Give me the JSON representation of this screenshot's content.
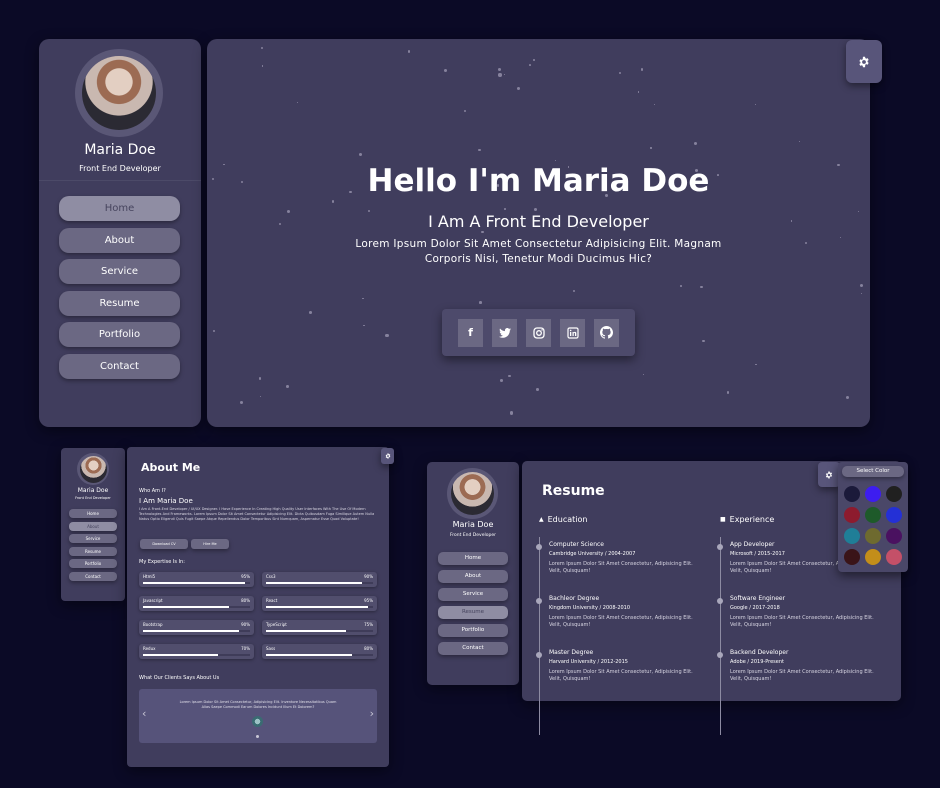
{
  "main": {
    "profile": {
      "name": "Maria Doe",
      "role": "Front End Developer"
    },
    "nav": [
      "Home",
      "About",
      "Service",
      "Resume",
      "Portfolio",
      "Contact"
    ],
    "nav_active": "Home",
    "hero": {
      "title": "Hello I'm Maria Doe",
      "subtitle": "I Am A Front End Developer",
      "description": "Lorem Ipsum Dolor Sit Amet Consectetur Adipisicing Elit. Magnam Corporis Nisi, Tenetur Modi Ducimus Hic?"
    },
    "social": [
      "facebook-icon",
      "twitter-icon",
      "instagram-icon",
      "linkedin-icon",
      "github-icon"
    ]
  },
  "about_page": {
    "profile": {
      "name": "Maria Doe",
      "role": "Front End Developer"
    },
    "nav": [
      "Home",
      "About",
      "Service",
      "Resume",
      "Portfolio",
      "Contact"
    ],
    "nav_active": "About",
    "title": "About Me",
    "who_label": "Who Am I?",
    "who_name": "I Am Maria Doe",
    "bio": "I Am A Front-End Developer / UI/UX Designer. I Have Experience In Creating High Quality User Interfaces With The Use Of Modern Technologies And Frameworks. Lorem Ipsum Dolor Sit Amet Consectetur Adipisicing Elit. Dicta Quibusdam Fuga Similique Autem Nulla Natus Optio Eligendi Quis Fugit Saepe Atque Repellendus Dolor Temporibus Sint Numquam, Aspernatur Esse Quod Voluptate!",
    "buttons": [
      "Download CV",
      "Hire Me"
    ],
    "expertise_title": "My Expertise Is In:",
    "skills": [
      {
        "name": "Html5",
        "value": 95,
        "label": "95%"
      },
      {
        "name": "Css3",
        "value": 90,
        "label": "90%"
      },
      {
        "name": "Javascript",
        "value": 80,
        "label": "80%"
      },
      {
        "name": "React",
        "value": 95,
        "label": "95%"
      },
      {
        "name": "Bootstrap",
        "value": 90,
        "label": "90%"
      },
      {
        "name": "TypeScript",
        "value": 75,
        "label": "75%"
      },
      {
        "name": "Redux",
        "value": 70,
        "label": "70%"
      },
      {
        "name": "Sass",
        "value": 80,
        "label": "80%"
      }
    ],
    "clients_title": "What Our Clients Says About Us",
    "testimonial": "Lorem Ipsum Dolor Sit Amet Consectetur, Adipisicing Elit. Inventore Necessitatibus Quam Alias Saepe Commodi Earum Dolores Incidunt Illum Et Dolorem?"
  },
  "resume_page": {
    "profile": {
      "name": "Maria Doe",
      "role": "Front End Developer"
    },
    "nav": [
      "Home",
      "About",
      "Service",
      "Resume",
      "Portfolio",
      "Contact"
    ],
    "nav_active": "Resume",
    "title": "Resume",
    "education_title": "Education",
    "experience_title": "Experience",
    "education": [
      {
        "title": "Computer Science",
        "sub": "Cambridge University / 2004-2007",
        "desc": "Lorem Ipsum Dolor Sit Amet Consectetur, Adipisicing Elit. Velit, Quisquam!"
      },
      {
        "title": "Bachleor Degree",
        "sub": "Kingdom University / 2008-2010",
        "desc": "Lorem Ipsum Dolor Sit Amet Consectetur, Adipisicing Elit. Velit, Quisquam!"
      },
      {
        "title": "Master Degree",
        "sub": "Harvard University / 2012-2015",
        "desc": "Lorem Ipsum Dolor Sit Amet Consectetur, Adipisicing Elit. Velit, Quisquam!"
      }
    ],
    "experience": [
      {
        "title": "App Developer",
        "sub": "Microsoft / 2015-2017",
        "desc": "Lorem Ipsum Dolor Sit Amet Consectetur, Adipisicing Elit. Velit, Quisquam!"
      },
      {
        "title": "Software Engineer",
        "sub": "Google / 2017-2018",
        "desc": "Lorem Ipsum Dolor Sit Amet Consectetur, Adipisicing Elit. Velit, Quisquam!"
      },
      {
        "title": "Backend Developer",
        "sub": "Adobe / 2019-Present",
        "desc": "Lorem Ipsum Dolor Sit Amet Consectetur, Adipisicing Elit. Velit, Quisquam!"
      }
    ],
    "color_picker": {
      "label": "Select Color",
      "colors": [
        "#1b1a3a",
        "#3d1df0",
        "#202020",
        "#8d1b2e",
        "#1e5a2a",
        "#2430d6",
        "#1f7e97",
        "#6e6a2f",
        "#4a1160",
        "#3a1418",
        "#c38e1a",
        "#c45068"
      ]
    }
  },
  "colors": {
    "background": "#0b0a26",
    "panel": "#403d5d",
    "button": "#6b6883",
    "button_active": "#8f8da3"
  }
}
